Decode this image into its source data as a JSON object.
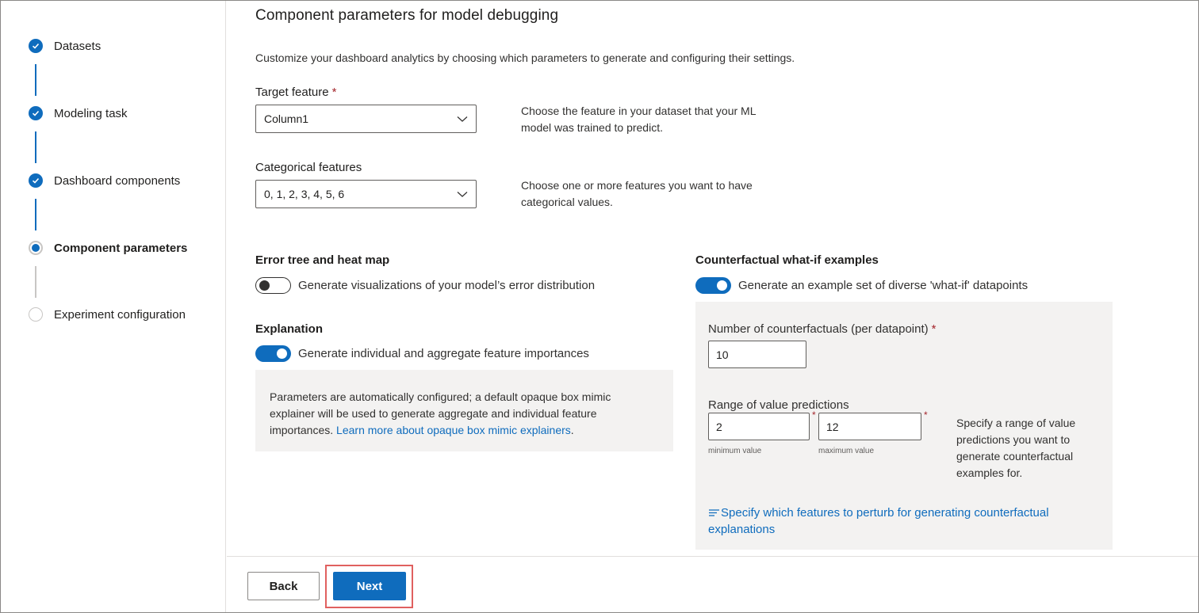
{
  "sidebar": {
    "steps": [
      {
        "label": "Datasets",
        "state": "done"
      },
      {
        "label": "Modeling task",
        "state": "done"
      },
      {
        "label": "Dashboard components",
        "state": "done"
      },
      {
        "label": "Component parameters",
        "state": "current"
      },
      {
        "label": "Experiment configuration",
        "state": "pending"
      }
    ]
  },
  "main": {
    "title": "Component parameters for model debugging",
    "description": "Customize your dashboard analytics by choosing which parameters to generate and configuring their settings.",
    "target_feature": {
      "label": "Target feature",
      "required_mark": "*",
      "value": "Column1",
      "helper": "Choose the feature in your dataset that your ML model was trained to predict."
    },
    "categorical_features": {
      "label": "Categorical features",
      "value": "0, 1, 2, 3, 4, 5, 6",
      "helper": "Choose one or more features you want to have categorical values."
    },
    "error_tree": {
      "title": "Error tree and heat map",
      "toggle_on": false,
      "toggle_text": "Generate visualizations of your model’s error distribution"
    },
    "explanation": {
      "title": "Explanation",
      "toggle_on": true,
      "toggle_text": "Generate individual and aggregate feature importances",
      "info_text": "Parameters are automatically configured; a default opaque box mimic explainer will be used to generate aggregate and individual feature importances.",
      "info_link": "Learn more about opaque box mimic explainers",
      "info_suffix": "."
    },
    "counterfactual": {
      "title": "Counterfactual what-if examples",
      "toggle_on": true,
      "toggle_text": "Generate an example set of diverse 'what-if' datapoints",
      "num_label": "Number of counterfactuals (per datapoint)",
      "num_value": "10",
      "range_label": "Range of value predictions",
      "min_value": "2",
      "max_value": "12",
      "min_caption": "minimum value",
      "max_caption": "maximum value",
      "range_helper": "Specify a range of value predictions you want to generate counterfactual examples for.",
      "perturb_link": "Specify which features to perturb for generating counterfactual explanations",
      "required_mark": "*"
    }
  },
  "footer": {
    "back_label": "Back",
    "next_label": "Next"
  },
  "colors": {
    "accent": "#0f6cbd",
    "required": "#a4262c",
    "highlight": "#e0605f"
  }
}
